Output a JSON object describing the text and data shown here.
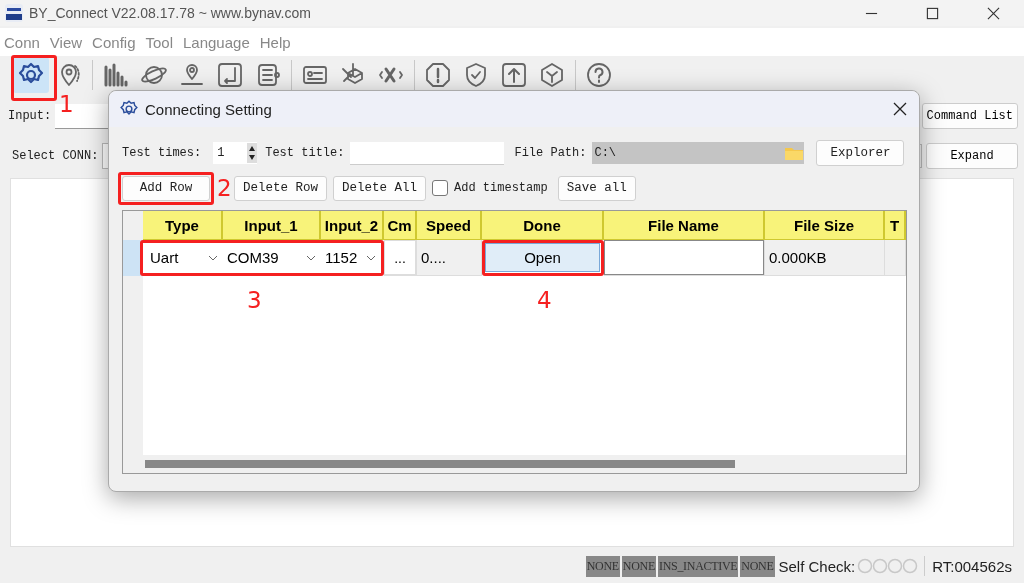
{
  "window": {
    "title": "BY_Connect V22.08.17.78 ~ www.bynav.com"
  },
  "menu": [
    "Conn",
    "View",
    "Config",
    "Tool",
    "Language",
    "Help"
  ],
  "toolbar": [
    [
      {
        "kind": "gear",
        "selected": true,
        "annotation": "1"
      },
      {
        "kind": "pin",
        "selected": false
      }
    ],
    [
      {
        "kind": "bars",
        "selected": false
      },
      {
        "kind": "planet",
        "selected": false
      },
      {
        "kind": "location",
        "selected": false
      },
      {
        "kind": "axis",
        "selected": false
      },
      {
        "kind": "list",
        "selected": false
      }
    ],
    [
      {
        "kind": "card",
        "selected": false
      },
      {
        "kind": "satellite",
        "selected": false
      },
      {
        "kind": "xcode",
        "selected": false
      }
    ],
    [
      {
        "kind": "alert",
        "selected": false
      },
      {
        "kind": "shield",
        "selected": false
      },
      {
        "kind": "upload",
        "selected": false
      },
      {
        "kind": "cube",
        "selected": false
      }
    ],
    [
      {
        "kind": "help",
        "selected": false
      }
    ]
  ],
  "input_row": {
    "label": "Input:",
    "button": "Command List"
  },
  "conn_row": {
    "label": "Select CONN:",
    "button": "Expand"
  },
  "dialog": {
    "title": "Connecting Setting",
    "test_times": {
      "label": "Test times:",
      "value": "1"
    },
    "test_title": {
      "label": "Test title:"
    },
    "file_path": {
      "label": "File Path:",
      "value": "C:\\"
    },
    "explorer": "Explorer",
    "buttons": [
      {
        "label": "Add Row",
        "annotation": "2"
      },
      {
        "label": "Delete Row"
      },
      {
        "label": "Delete All"
      }
    ],
    "timestamp": {
      "label": "Add timestamp",
      "checked": false
    },
    "save_all": "Save all",
    "table": {
      "columns": [
        "Type",
        "Input_1",
        "Input_2",
        "Cm",
        "Speed",
        "Done",
        "File Name",
        "File Size",
        "T"
      ],
      "rows": [
        {
          "annotation": "3",
          "type": "Uart",
          "input_1": "COM39",
          "input_2": "1152",
          "cmd": "...",
          "speed": "0....",
          "done": "Open",
          "done_annotation": "4",
          "file_size": "0.000KB"
        }
      ]
    }
  },
  "status_bar": {
    "tags": [
      "NONE",
      "NONE",
      "INS_INACTIVE",
      "NONE"
    ],
    "self_check": "Self Check:",
    "rt": "RT:004562s"
  }
}
